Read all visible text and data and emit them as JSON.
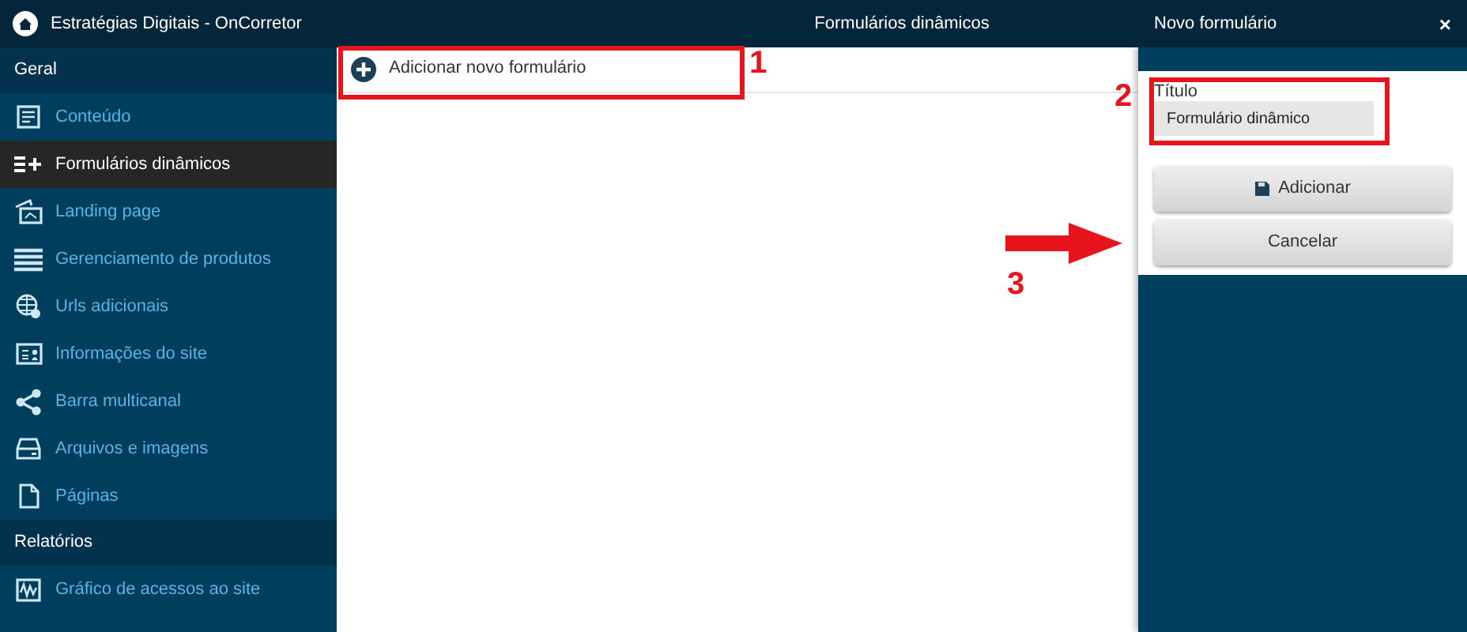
{
  "app_title": "Estratégias Digitais - OnCorretor",
  "sidebar": {
    "groups": [
      {
        "label": "Geral",
        "items": [
          {
            "label": "Conteúdo",
            "selected": false
          },
          {
            "label": "Formulários dinâmicos",
            "selected": true
          },
          {
            "label": "Landing page",
            "selected": false
          },
          {
            "label": "Gerenciamento de produtos",
            "selected": false
          },
          {
            "label": "Urls adicionais",
            "selected": false
          },
          {
            "label": "Informações do site",
            "selected": false
          },
          {
            "label": "Barra multicanal",
            "selected": false
          },
          {
            "label": "Arquivos e imagens",
            "selected": false
          },
          {
            "label": "Páginas",
            "selected": false
          }
        ]
      },
      {
        "label": "Relatórios",
        "items": [
          {
            "label": "Gráfico de acessos ao site",
            "selected": false
          }
        ]
      }
    ]
  },
  "main": {
    "title": "Formulários dinâmicos",
    "add_button": "Adicionar novo formulário"
  },
  "panel": {
    "title": "Novo formulário",
    "close": "×",
    "field_label": "Título",
    "field_value": "Formulário dinâmico",
    "buttons": [
      "Adicionar",
      "Cancelar"
    ]
  },
  "annotations": [
    "1",
    "2",
    "3"
  ]
}
